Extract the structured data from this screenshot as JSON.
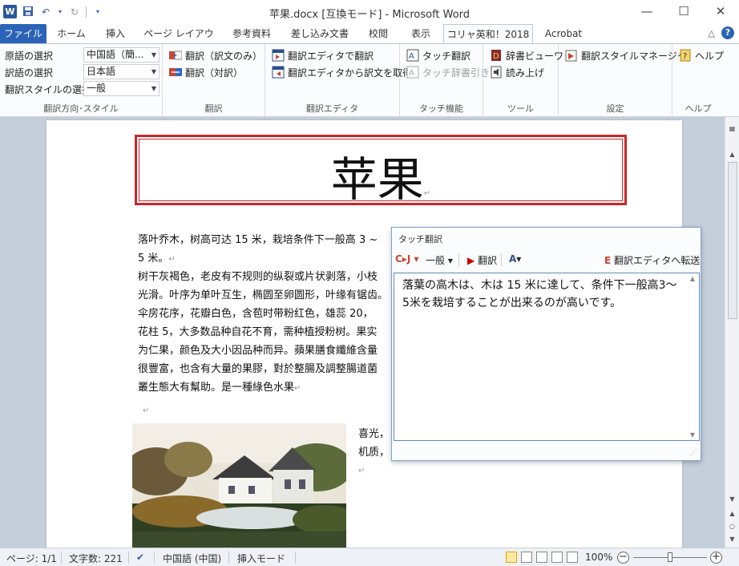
{
  "window": {
    "title": "苹果.docx [互換モード] - Microsoft Word",
    "app_icon": "W",
    "minimize": "—",
    "maximize": "☐",
    "close": "✕"
  },
  "tabs": [
    {
      "label": "ファイル"
    },
    {
      "label": "ホーム"
    },
    {
      "label": "挿入"
    },
    {
      "label": "ページ レイアウト"
    },
    {
      "label": "参考資料"
    },
    {
      "label": "差し込み文書"
    },
    {
      "label": "校閲"
    },
    {
      "label": "表示"
    },
    {
      "label": "コリャ英和！2018"
    },
    {
      "label": "Acrobat"
    }
  ],
  "ribbon": {
    "direction_group": {
      "source_label": "原語の選択",
      "source_value": "中国語（簡...",
      "target_label": "訳語の選択",
      "target_value": "日本語",
      "style_label": "翻訳スタイルの選択",
      "style_value": "一般",
      "group_label": "翻訳方向･スタイル"
    },
    "translate_group": {
      "only": "翻訳（訳文のみ）",
      "pair": "翻訳（対訳）",
      "group_label": "翻訳"
    },
    "editor_group": {
      "to_editor": "翻訳エディタで翻訳",
      "from_editor": "翻訳エディタから訳文を取得",
      "group_label": "翻訳エディタ"
    },
    "touch_group": {
      "touch_translate": "タッチ翻訳",
      "touch_dict": "タッチ辞書引き",
      "group_label": "タッチ機能"
    },
    "tools_group": {
      "dict_viewer": "辞書ビューワ",
      "read_aloud": "読み上げ",
      "group_label": "ツール"
    },
    "settings_group": {
      "style_manager": "翻訳スタイルマネージャ",
      "group_label": "設定"
    },
    "help_group": {
      "help": "ヘルプ",
      "group_label": "ヘルプ"
    }
  },
  "document": {
    "title": "苹果",
    "lines": [
      "落叶乔木，树高可达 15 米，栽培条件下一般高 3 ~",
      "5 米。",
      "树干灰褐色，老皮有不规则的纵裂或片状剥落，小枝",
      "光滑。叶序为单叶互生，椭圆至卵圆形，叶缘有锯齿。",
      "伞房花序，花瓣白色，含苞时带粉红色，雄蕊 20，",
      "花柱 5，大多数品种自花不育，需种植授粉树。果实",
      "为仁果，颜色及大小因品种而异。蘋果膳食纖維含量",
      "很豐富，也含有大量的果膠，對於整腸及調整腸道菌",
      "叢生態大有幫助。是一種綠色水果"
    ],
    "side_lines": [
      "喜光，",
      "机质，"
    ]
  },
  "touch_panel": {
    "title": "タッチ翻訳",
    "lang_btn": "J",
    "style_btn": "一般",
    "translate_btn": "翻訳",
    "send_btn": "翻訳エディタへ転送",
    "output": "落葉の高木は、木は 15 米に達して、条件下一般高3～5米を栽培することが出来るのが高いです。"
  },
  "status": {
    "page": "ページ: 1/1",
    "words": "文字数: 221",
    "language": "中国語 (中国)",
    "mode": "挿入モード",
    "zoom": "100%",
    "zoom_minus": "−",
    "zoom_plus": "+"
  },
  "colors": {
    "accent": "#2b63b8",
    "title_border": "#c8262c",
    "panel_border": "#5f8cc0"
  }
}
